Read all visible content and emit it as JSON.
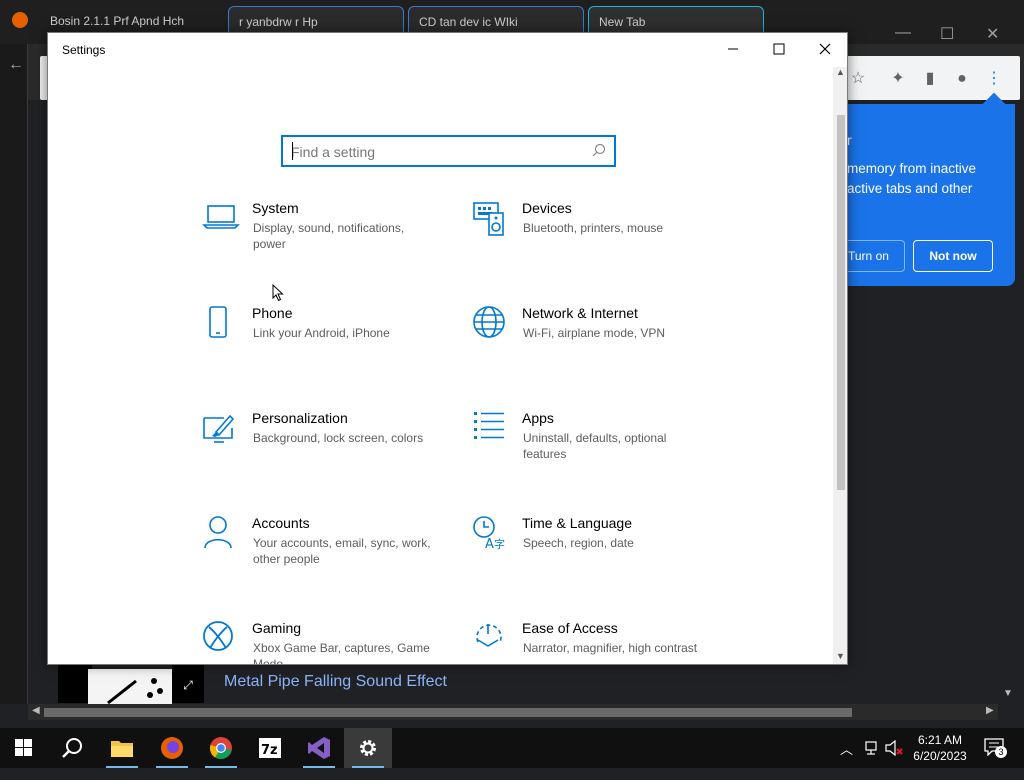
{
  "browser": {
    "tabs": [
      {
        "label": "Bosin 2.1.1 Prf Apnd Hch"
      },
      {
        "label": "r yanbdrw r Hp"
      },
      {
        "label": "CD tan dev ic WIki"
      },
      {
        "label": "New Tab"
      }
    ],
    "notification": {
      "title": "r",
      "body": "memory from inactive active tabs and other",
      "turn_on": "Turn on",
      "not_now": "Not now"
    },
    "media_title": "Metal Pipe Falling Sound Effect"
  },
  "settings": {
    "window_title": "Settings",
    "search": {
      "placeholder": "Find a setting"
    },
    "tiles": [
      {
        "name": "System",
        "desc": "Display, sound, notifications, power",
        "icon": "laptop-icon"
      },
      {
        "name": "Devices",
        "desc": "Bluetooth, printers, mouse",
        "icon": "keyboard-speaker-icon"
      },
      {
        "name": "Phone",
        "desc": "Link your Android, iPhone",
        "icon": "phone-icon"
      },
      {
        "name": "Network & Internet",
        "desc": "Wi-Fi, airplane mode, VPN",
        "icon": "globe-icon"
      },
      {
        "name": "Personalization",
        "desc": "Background, lock screen, colors",
        "icon": "paint-icon"
      },
      {
        "name": "Apps",
        "desc": "Uninstall, defaults, optional features",
        "icon": "apps-list-icon"
      },
      {
        "name": "Accounts",
        "desc": "Your accounts, email, sync, work, other people",
        "icon": "person-icon"
      },
      {
        "name": "Time & Language",
        "desc": "Speech, region, date",
        "icon": "time-language-icon"
      },
      {
        "name": "Gaming",
        "desc": "Xbox Game Bar, captures, Game Mode",
        "icon": "xbox-icon"
      },
      {
        "name": "Ease of Access",
        "desc": "Narrator, magnifier, high contrast",
        "icon": "ease-of-access-icon"
      }
    ]
  },
  "taskbar": {
    "apps": [
      "start",
      "search",
      "file-explorer",
      "firefox",
      "chrome",
      "7zip",
      "visual-studio",
      "settings"
    ],
    "clock_time": "6:21 AM",
    "clock_date": "6/20/2023",
    "notification_count": "3",
    "accent": "#0078d4"
  }
}
